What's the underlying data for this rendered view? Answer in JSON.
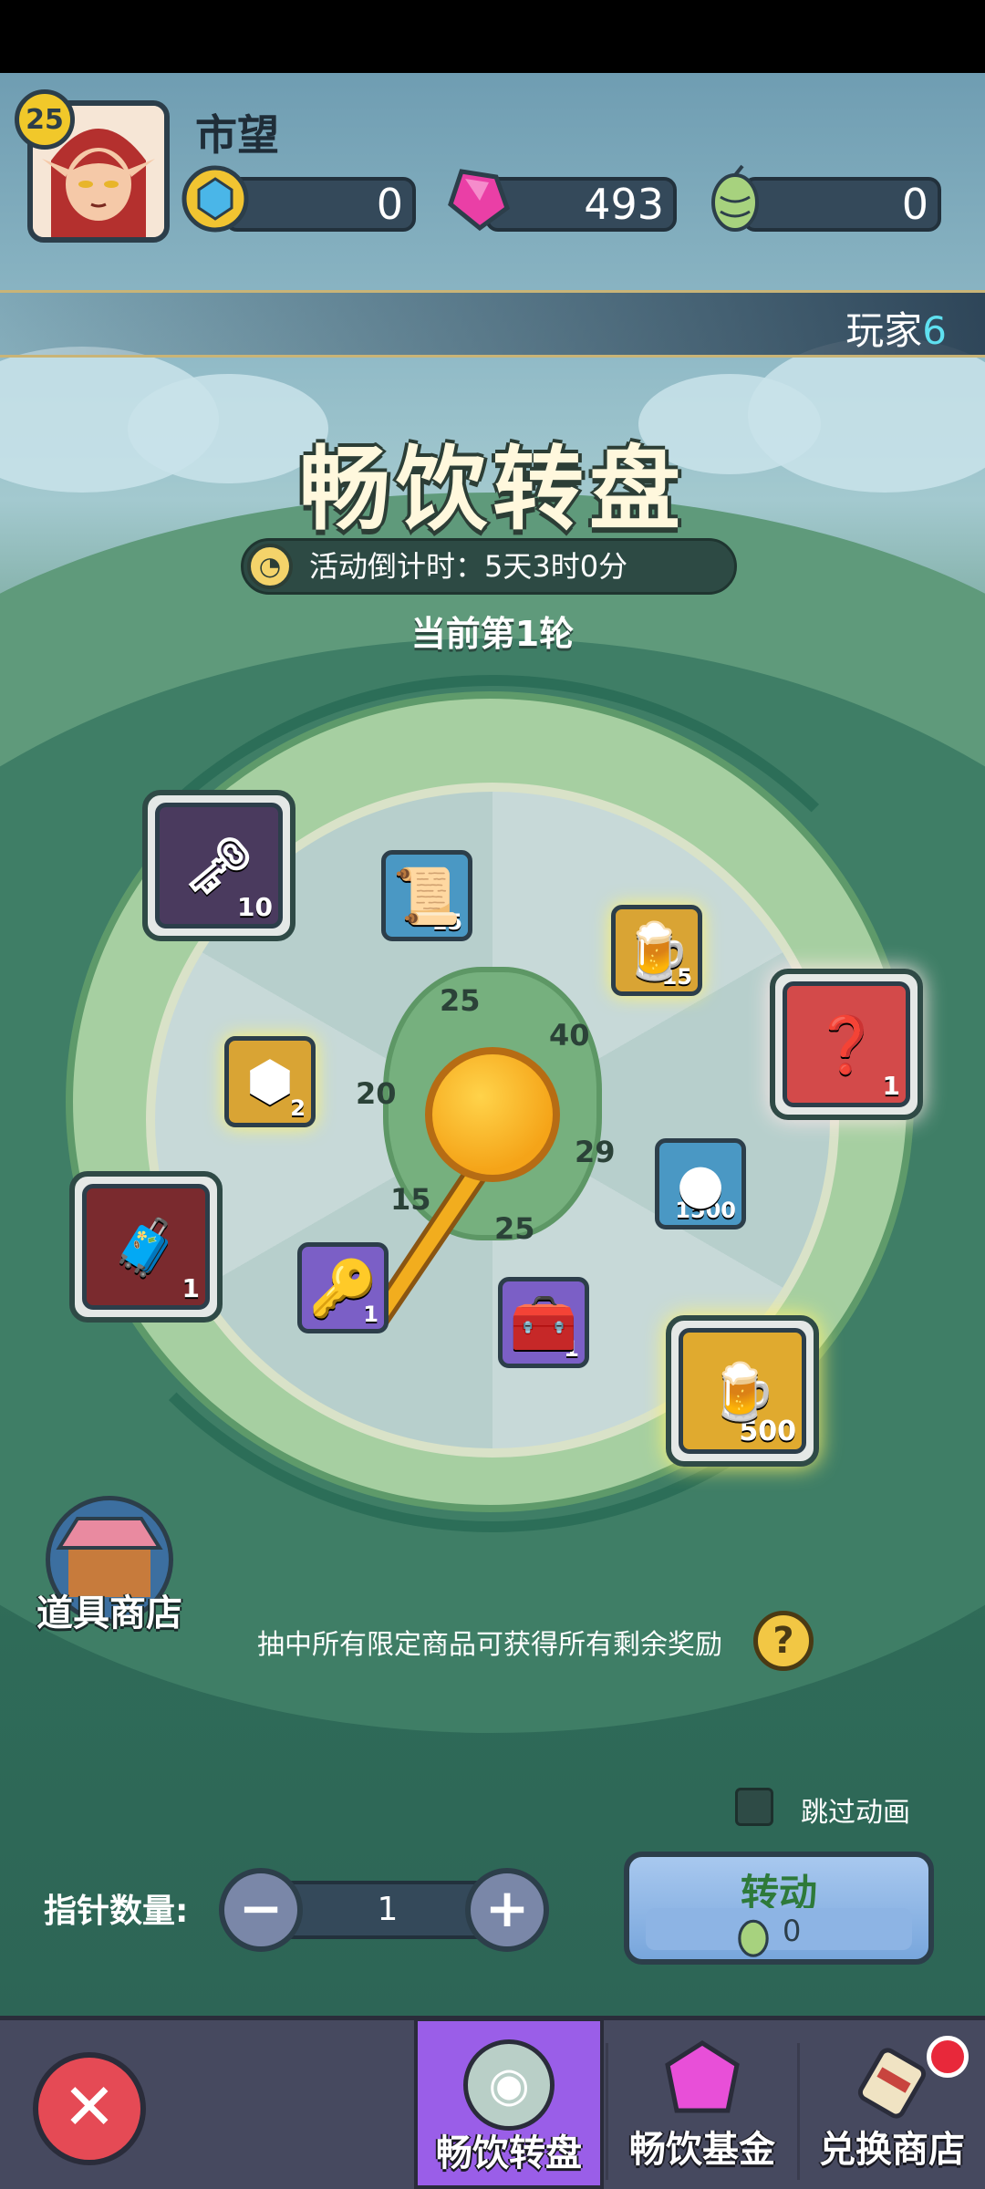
{
  "player": {
    "level": "25",
    "name": "市望"
  },
  "currencies": [
    {
      "icon": "blue-gem-coin-icon",
      "value": "0"
    },
    {
      "icon": "pink-gem-icon",
      "value": "493"
    },
    {
      "icon": "hop-icon",
      "value": "0"
    }
  ],
  "banner": {
    "label": "玩家",
    "number": "6"
  },
  "event": {
    "title": "畅饮转盘",
    "countdown": "活动倒计时：5天3时0分",
    "round": "当前第1轮"
  },
  "wheel": {
    "hub_numbers": [
      "25",
      "40",
      "29",
      "25",
      "15",
      "20"
    ],
    "inner_items": [
      {
        "name": "scroll-item",
        "count": "15"
      },
      {
        "name": "beer-mug-item",
        "count": "15"
      },
      {
        "name": "yellow-gem-item",
        "count": "2"
      },
      {
        "name": "gold-coin-item",
        "count": "1500"
      },
      {
        "name": "gold-key-item",
        "count": "1"
      },
      {
        "name": "green-chest-item",
        "count": "1"
      }
    ],
    "outer_items": [
      {
        "name": "purple-key-prize",
        "count": "10"
      },
      {
        "name": "mystery-gems-prize",
        "count": "1"
      },
      {
        "name": "red-chest-prize",
        "count": "1"
      },
      {
        "name": "big-beer-prize",
        "count": "500"
      }
    ]
  },
  "shop": {
    "label": "道具商店"
  },
  "note": "抽中所有限定商品可获得所有剩余奖励",
  "help_label": "?",
  "skip_animation": {
    "label": "跳过动画",
    "checked": false
  },
  "needle": {
    "label": "指针数量:",
    "value": "1",
    "minus": "−",
    "plus": "+"
  },
  "spin": {
    "label": "转动",
    "cost": "0"
  },
  "tabs": [
    {
      "label": "畅饮转盘",
      "active": true
    },
    {
      "label": "畅饮基金",
      "active": false
    },
    {
      "label": "兑换商店",
      "active": false
    }
  ],
  "close_label": "✕"
}
